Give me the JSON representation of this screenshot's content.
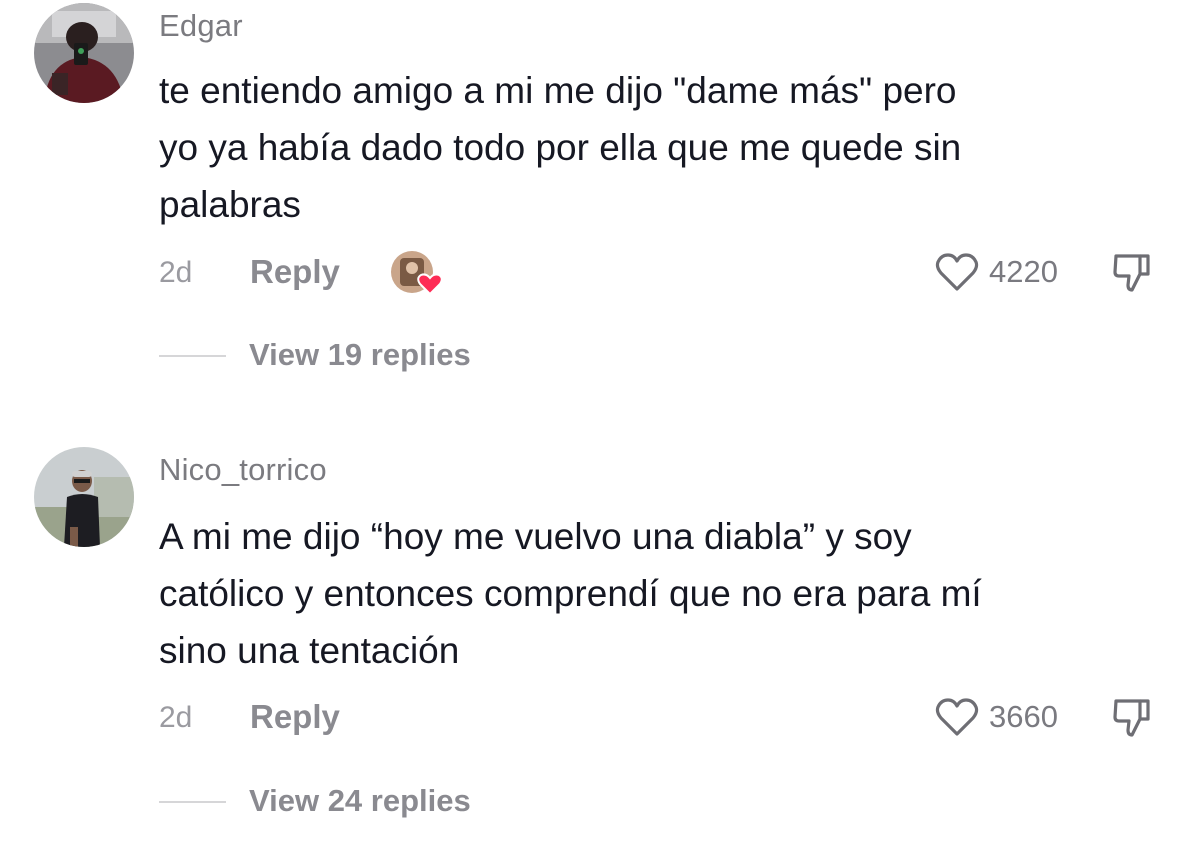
{
  "comments": [
    {
      "username": "Edgar",
      "text_lines": [
        "te entiendo amigo a mi me dijo \"dame más\" pero",
        "yo ya había dado todo por ella que me quede sin",
        "palabras"
      ],
      "time": "2d",
      "reply_label": "Reply",
      "likes": "4220",
      "view_replies": "View 19 replies",
      "creator_liked": true
    },
    {
      "username": "Nico_torrico",
      "text_lines": [
        "A mi me dijo “hoy me vuelvo una diabla” y soy",
        "católico y entonces comprendí que no era para mí",
        "sino una tentación"
      ],
      "time": "2d",
      "reply_label": "Reply",
      "likes": "3660",
      "view_replies": "View 24 replies",
      "creator_liked": false
    }
  ],
  "icons": {
    "like": "heart-outline-icon",
    "dislike": "thumbs-down-icon",
    "creator_badge": "red-heart-icon"
  },
  "colors": {
    "heart_badge": "#fe2c55",
    "text": "#161823",
    "muted": "#8a8a90"
  }
}
